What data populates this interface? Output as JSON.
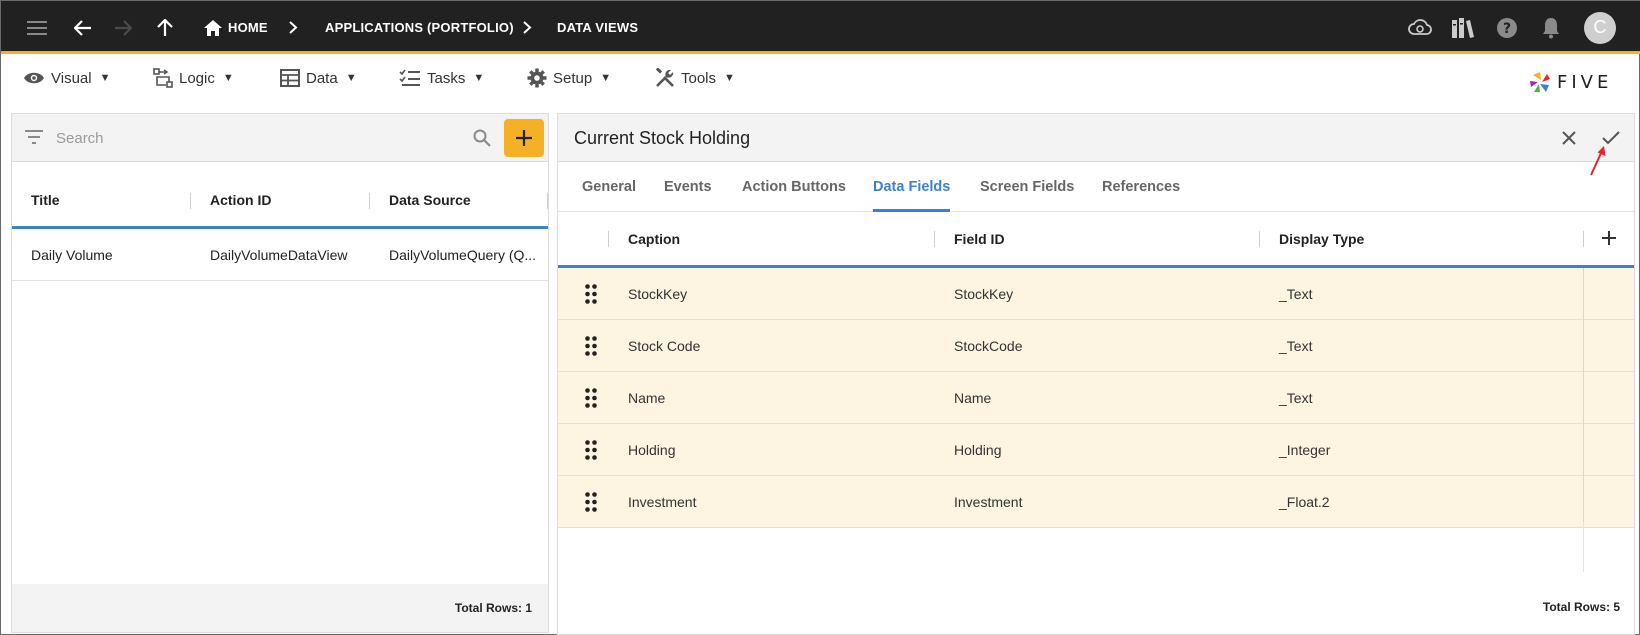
{
  "topbar": {
    "home_label": "HOME",
    "crumb_apps": "APPLICATIONS (PORTFOLIO)",
    "crumb_views": "DATA VIEWS",
    "avatar_letter": "C",
    "icons": [
      "menu-icon",
      "back-icon",
      "forward-icon",
      "up-icon",
      "home-icon",
      "cloud-sync-icon",
      "library-icon",
      "help-icon",
      "bell-icon"
    ]
  },
  "menubar": {
    "visual": "Visual",
    "logic": "Logic",
    "data": "Data",
    "tasks": "Tasks",
    "setup": "Setup",
    "tools": "Tools",
    "logo_text": "FIVE"
  },
  "left_panel": {
    "search_placeholder": "Search",
    "columns": [
      "Title",
      "Action ID",
      "Data Source"
    ],
    "rows": [
      {
        "title": "Daily Volume",
        "action_id": "DailyVolumeDataView",
        "data_source": "DailyVolumeQuery (Q..."
      }
    ],
    "total_rows": "Total Rows: 1"
  },
  "right_panel": {
    "title": "Current Stock Holding",
    "tabs": [
      "General",
      "Events",
      "Action Buttons",
      "Data Fields",
      "Screen Fields",
      "References"
    ],
    "active_tab": "Data Fields",
    "columns": [
      "Caption",
      "Field ID",
      "Display Type"
    ],
    "rows": [
      {
        "caption": "StockKey",
        "field_id": "StockKey",
        "display_type": "_Text"
      },
      {
        "caption": "Stock Code",
        "field_id": "StockCode",
        "display_type": "_Text"
      },
      {
        "caption": "Name",
        "field_id": "Name",
        "display_type": "_Text"
      },
      {
        "caption": "Holding",
        "field_id": "Holding",
        "display_type": "_Integer"
      },
      {
        "caption": "Investment",
        "field_id": "Investment",
        "display_type": "_Float.2"
      }
    ],
    "total_rows": "Total Rows: 5"
  },
  "colors": {
    "topbar_bg": "#212121",
    "accent_yellow": "#f5b125",
    "active_blue": "#3d7fd6",
    "row_highlight": "#fdf4e1",
    "annotation_red": "#e8232a"
  }
}
